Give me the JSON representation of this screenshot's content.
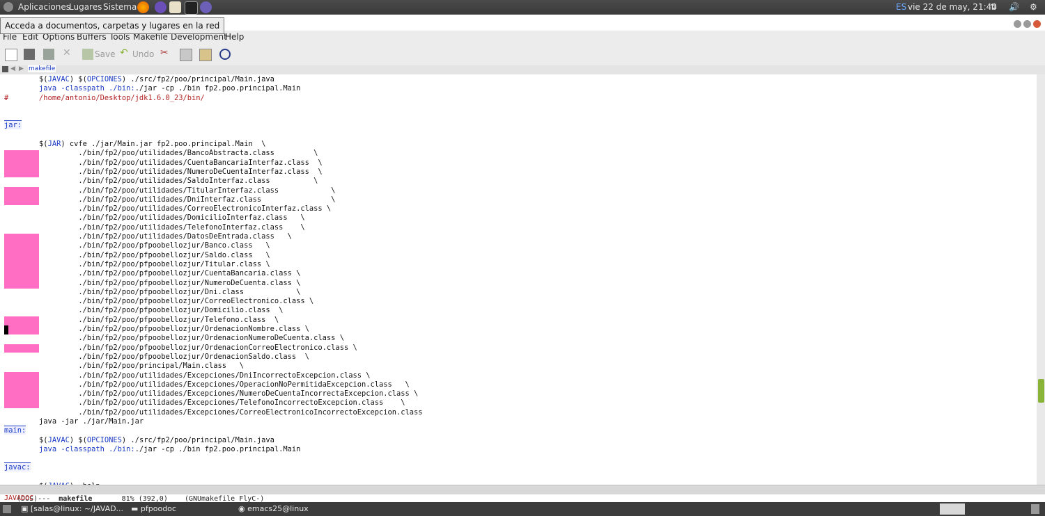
{
  "top_panel": {
    "menus": [
      "Aplicaciones",
      "Lugares",
      "Sistema"
    ],
    "keyboard_layout": "ES",
    "datetime": "vie 22 de may, 21:40"
  },
  "tooltip": "Acceda a documentos, carpetas y lugares en la red",
  "menubar": [
    "File",
    "Edit",
    "Options",
    "Buffers",
    "Tools",
    "Makefile",
    "Development",
    "Help"
  ],
  "toolbar": {
    "save_label": "Save",
    "undo_label": "Undo"
  },
  "tab": {
    "name": "makefile"
  },
  "modeline": {
    "prefix": "-(DOS)---",
    "buffer": "makefile",
    "position": "81% (392,0)",
    "mode": "(GNUmakefile FlyC-)"
  },
  "minibuffer": "JAVADOC",
  "taskbar": {
    "tasks": [
      "[salas@linux: ~/JAVAD...",
      "pfpoodoc",
      "emacs25@linux"
    ]
  },
  "colors": {
    "accent": "#1b3bc4",
    "comment": "#b22222",
    "highlight": "#ff6ec2",
    "scroll_thumb": "#8ab438"
  },
  "lines": [
    {
      "segs": [
        {
          "t": "        "
        },
        {
          "t": "$(",
          "c": ""
        },
        {
          "t": "JAVAC",
          "c": "vr"
        },
        {
          "t": ") $(",
          "c": ""
        },
        {
          "t": "OPCIONES",
          "c": "vr"
        },
        {
          "t": ") ./src/fp2/poo/principal/Main.java"
        }
      ]
    },
    {
      "segs": [
        {
          "t": "        "
        },
        {
          "t": "java -classpath ./bin:",
          "c": "kw"
        },
        {
          "t": "./jar -cp ./bin fp2.poo.principal.Main"
        }
      ]
    },
    {
      "segs": [
        {
          "t": "#       ",
          "c": "cm"
        },
        {
          "t": "/home/antonio/Desktop/jdk1.6.0_23/bin/",
          "c": "cm"
        }
      ]
    },
    {
      "segs": [
        {
          "t": ""
        }
      ]
    },
    {
      "segs": [
        {
          "t": ""
        }
      ]
    },
    {
      "segs": [
        {
          "t": "jar:",
          "c": "tg"
        }
      ]
    },
    {
      "segs": [
        {
          "t": ""
        }
      ]
    },
    {
      "segs": [
        {
          "t": "        $("
        },
        {
          "t": "JAR",
          "c": "vr"
        },
        {
          "t": ") cvfe ./jar/Main.jar fp2.poo.principal.Main  \\"
        }
      ]
    },
    {
      "segs": [
        {
          "t": "                 ./bin/fp2/poo/utilidades/BancoAbstracta.class         \\"
        }
      ]
    },
    {
      "segs": [
        {
          "t": "                 ./bin/fp2/poo/utilidades/CuentaBancariaInterfaz.class  \\"
        }
      ]
    },
    {
      "segs": [
        {
          "t": "                 ./bin/fp2/poo/utilidades/NumeroDeCuentaInterfaz.class  \\"
        }
      ]
    },
    {
      "segs": [
        {
          "t": "                 ./bin/fp2/poo/utilidades/SaldoInterfaz.class          \\"
        }
      ]
    },
    {
      "segs": [
        {
          "t": "                 ./bin/fp2/poo/utilidades/TitularInterfaz.class            \\"
        }
      ]
    },
    {
      "segs": [
        {
          "t": "                 ./bin/fp2/poo/utilidades/DniInterfaz.class                \\"
        }
      ]
    },
    {
      "segs": [
        {
          "t": "                 ./bin/fp2/poo/utilidades/CorreoElectronicoInterfaz.class \\"
        }
      ]
    },
    {
      "segs": [
        {
          "t": "                 ./bin/fp2/poo/utilidades/DomicilioInterfaz.class   \\"
        }
      ]
    },
    {
      "segs": [
        {
          "t": "                 ./bin/fp2/poo/utilidades/TelefonoInterfaz.class    \\"
        }
      ]
    },
    {
      "segs": [
        {
          "t": "                 ./bin/fp2/poo/utilidades/DatosDeEntrada.class   \\"
        }
      ]
    },
    {
      "segs": [
        {
          "t": "                 ./bin/fp2/poo/pfpoobellozjur/Banco.class   \\"
        }
      ]
    },
    {
      "segs": [
        {
          "t": "                 ./bin/fp2/poo/pfpoobellozjur/Saldo.class   \\"
        }
      ]
    },
    {
      "segs": [
        {
          "t": "                 ./bin/fp2/poo/pfpoobellozjur/Titular.class \\"
        }
      ]
    },
    {
      "segs": [
        {
          "t": "                 ./bin/fp2/poo/pfpoobellozjur/CuentaBancaria.class \\"
        }
      ]
    },
    {
      "segs": [
        {
          "t": "                 ./bin/fp2/poo/pfpoobellozjur/NumeroDeCuenta.class \\"
        }
      ]
    },
    {
      "segs": [
        {
          "t": "                 ./bin/fp2/poo/pfpoobellozjur/Dni.class            \\"
        }
      ]
    },
    {
      "segs": [
        {
          "t": "                 ./bin/fp2/poo/pfpoobellozjur/CorreoElectronico.class \\"
        }
      ]
    },
    {
      "segs": [
        {
          "t": "                 ./bin/fp2/poo/pfpoobellozjur/Domicilio.class  \\"
        }
      ]
    },
    {
      "segs": [
        {
          "t": "                 ./bin/fp2/poo/pfpoobellozjur/Telefono.class  \\"
        }
      ]
    },
    {
      "segs": [
        {
          "t": "                 ./bin/fp2/poo/pfpoobellozjur/OrdenacionNombre.class \\"
        }
      ]
    },
    {
      "segs": [
        {
          "t": "                 ./bin/fp2/poo/pfpoobellozjur/OrdenacionNumeroDeCuenta.class \\"
        }
      ]
    },
    {
      "segs": [
        {
          "t": "                 ./bin/fp2/poo/pfpoobellozjur/OrdenacionCorreoElectronico.class \\"
        }
      ]
    },
    {
      "segs": [
        {
          "t": "                 ./bin/fp2/poo/pfpoobellozjur/OrdenacionSaldo.class  \\"
        }
      ]
    },
    {
      "segs": [
        {
          "t": "                 ./bin/fp2/poo/principal/Main.class   \\"
        }
      ]
    },
    {
      "segs": [
        {
          "t": "                 ./bin/fp2/poo/utilidades/Excepciones/DniIncorrectoExcepcion.class \\"
        }
      ]
    },
    {
      "segs": [
        {
          "t": "                 ./bin/fp2/poo/utilidades/Excepciones/OperacionNoPermitidaExcepcion.class   \\"
        }
      ]
    },
    {
      "segs": [
        {
          "t": "                 ./bin/fp2/poo/utilidades/Excepciones/NumeroDeCuentaIncorrectaExcepcion.class \\"
        }
      ]
    },
    {
      "segs": [
        {
          "t": "                 ./bin/fp2/poo/utilidades/Excepciones/TelefonoIncorrectoExcepcion.class    \\"
        }
      ]
    },
    {
      "segs": [
        {
          "t": "                 ./bin/fp2/poo/utilidades/Excepciones/CorreoElectronicoIncorrectoExcepcion.class"
        }
      ]
    },
    {
      "segs": [
        {
          "t": "        java -jar ./jar/Main.jar"
        }
      ]
    },
    {
      "segs": [
        {
          "t": "main:",
          "c": "tg"
        }
      ]
    },
    {
      "segs": [
        {
          "t": "        $("
        },
        {
          "t": "JAVAC",
          "c": "vr"
        },
        {
          "t": ") $("
        },
        {
          "t": "OPCIONES",
          "c": "vr"
        },
        {
          "t": ") ./src/fp2/poo/principal/Main.java"
        }
      ]
    },
    {
      "segs": [
        {
          "t": "        "
        },
        {
          "t": "java -classpath ./bin:",
          "c": "kw"
        },
        {
          "t": "./jar -cp ./bin fp2.poo.principal.Main"
        }
      ]
    },
    {
      "segs": [
        {
          "t": ""
        }
      ]
    },
    {
      "segs": [
        {
          "t": "javac:",
          "c": "tg"
        }
      ]
    },
    {
      "segs": [
        {
          "t": ""
        }
      ]
    },
    {
      "segs": [
        {
          "t": "        $("
        },
        {
          "t": "JAVAC",
          "c": "vr"
        },
        {
          "t": ") -help"
        }
      ]
    }
  ]
}
